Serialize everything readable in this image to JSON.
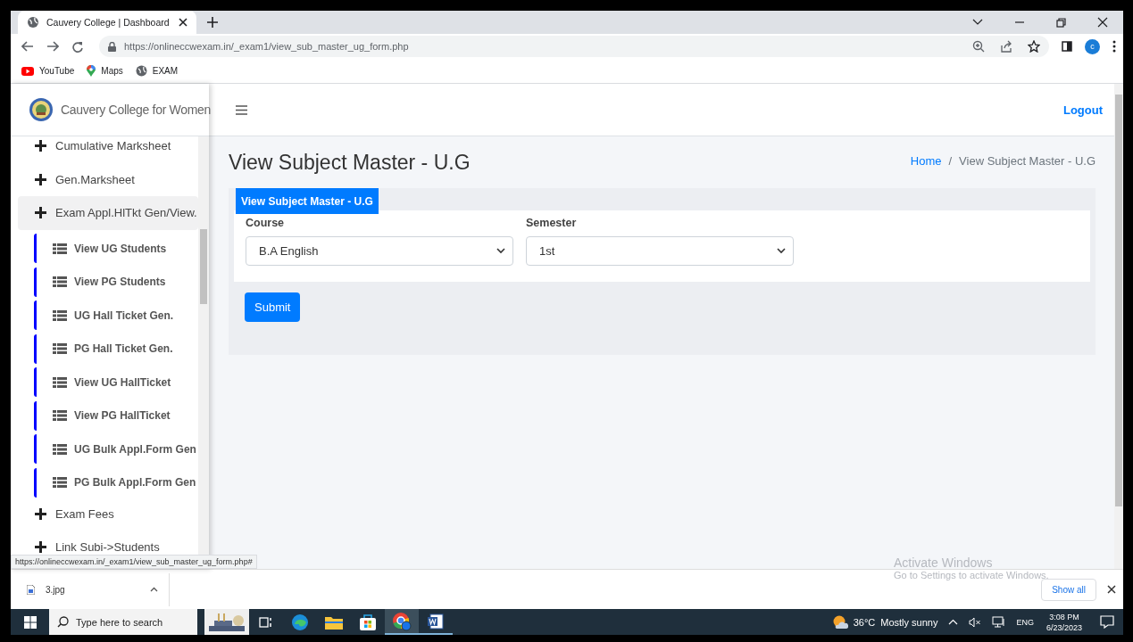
{
  "browser": {
    "tab_title": "Cauvery College | Dashboard",
    "url": "https://onlineccwexam.in/_exam1/view_sub_master_ug_form.php",
    "profile_initial": "c",
    "bookmarks": [
      {
        "kind": "youtube",
        "label": "YouTube"
      },
      {
        "kind": "maps",
        "label": "Maps"
      },
      {
        "kind": "globe",
        "label": "EXAM"
      }
    ]
  },
  "sidebar": {
    "brand": "Cauvery College for Women",
    "items": [
      {
        "label": "Cumulative Marksheet",
        "expanded": false
      },
      {
        "label": "Gen.Marksheet",
        "expanded": false
      },
      {
        "label": "Exam Appl.HlTkt Gen/View.",
        "expanded": true,
        "children": [
          {
            "label": "View UG Students"
          },
          {
            "label": "View PG Students"
          },
          {
            "label": "UG Hall Ticket Gen."
          },
          {
            "label": "PG Hall Ticket Gen."
          },
          {
            "label": "View UG HallTicket"
          },
          {
            "label": "View PG HallTicket"
          },
          {
            "label": "UG Bulk Appl.Form Gen"
          },
          {
            "label": "PG Bulk Appl.Form Gen"
          }
        ]
      },
      {
        "label": "Exam Fees",
        "expanded": false
      },
      {
        "label": "Link Subi->Students",
        "expanded": false
      }
    ]
  },
  "header": {
    "logout": "Logout"
  },
  "page": {
    "title": "View Subject Master - U.G",
    "breadcrumb_separator": "/",
    "breadcrumb": [
      {
        "label": "Home",
        "selected": false
      },
      {
        "label": "View Subject Master - U.G",
        "selected": true
      }
    ]
  },
  "form": {
    "tab": "View Subject Master - U.G",
    "fields": [
      {
        "label": "Course",
        "value": "B.A English"
      },
      {
        "label": "Semester",
        "value": "1st"
      }
    ],
    "submit": "Submit"
  },
  "status_url": "https://onlineccwexam.in/_exam1/view_sub_master_ug_form.php#",
  "downloads": {
    "file": "3.jpg",
    "show_all": "Show all"
  },
  "activation_notice": {
    "title": "Activate Windows",
    "text": "Go to Settings to activate Windows."
  },
  "taskbar": {
    "search_placeholder": "Type here to search",
    "apps": [
      {
        "kind": "news",
        "active": false,
        "running": false
      },
      {
        "kind": "taskview",
        "active": false,
        "running": false
      },
      {
        "kind": "edge",
        "active": false,
        "running": false
      },
      {
        "kind": "explorer",
        "active": false,
        "running": false
      },
      {
        "kind": "store",
        "active": false,
        "running": false
      },
      {
        "kind": "chrome",
        "active": true,
        "running": true
      },
      {
        "kind": "word",
        "active": false,
        "running": true
      }
    ],
    "temperature": "36°C",
    "weather": "Mostly sunny",
    "language": "ENG",
    "time": "3:08 PM",
    "date": "6/23/2023"
  }
}
